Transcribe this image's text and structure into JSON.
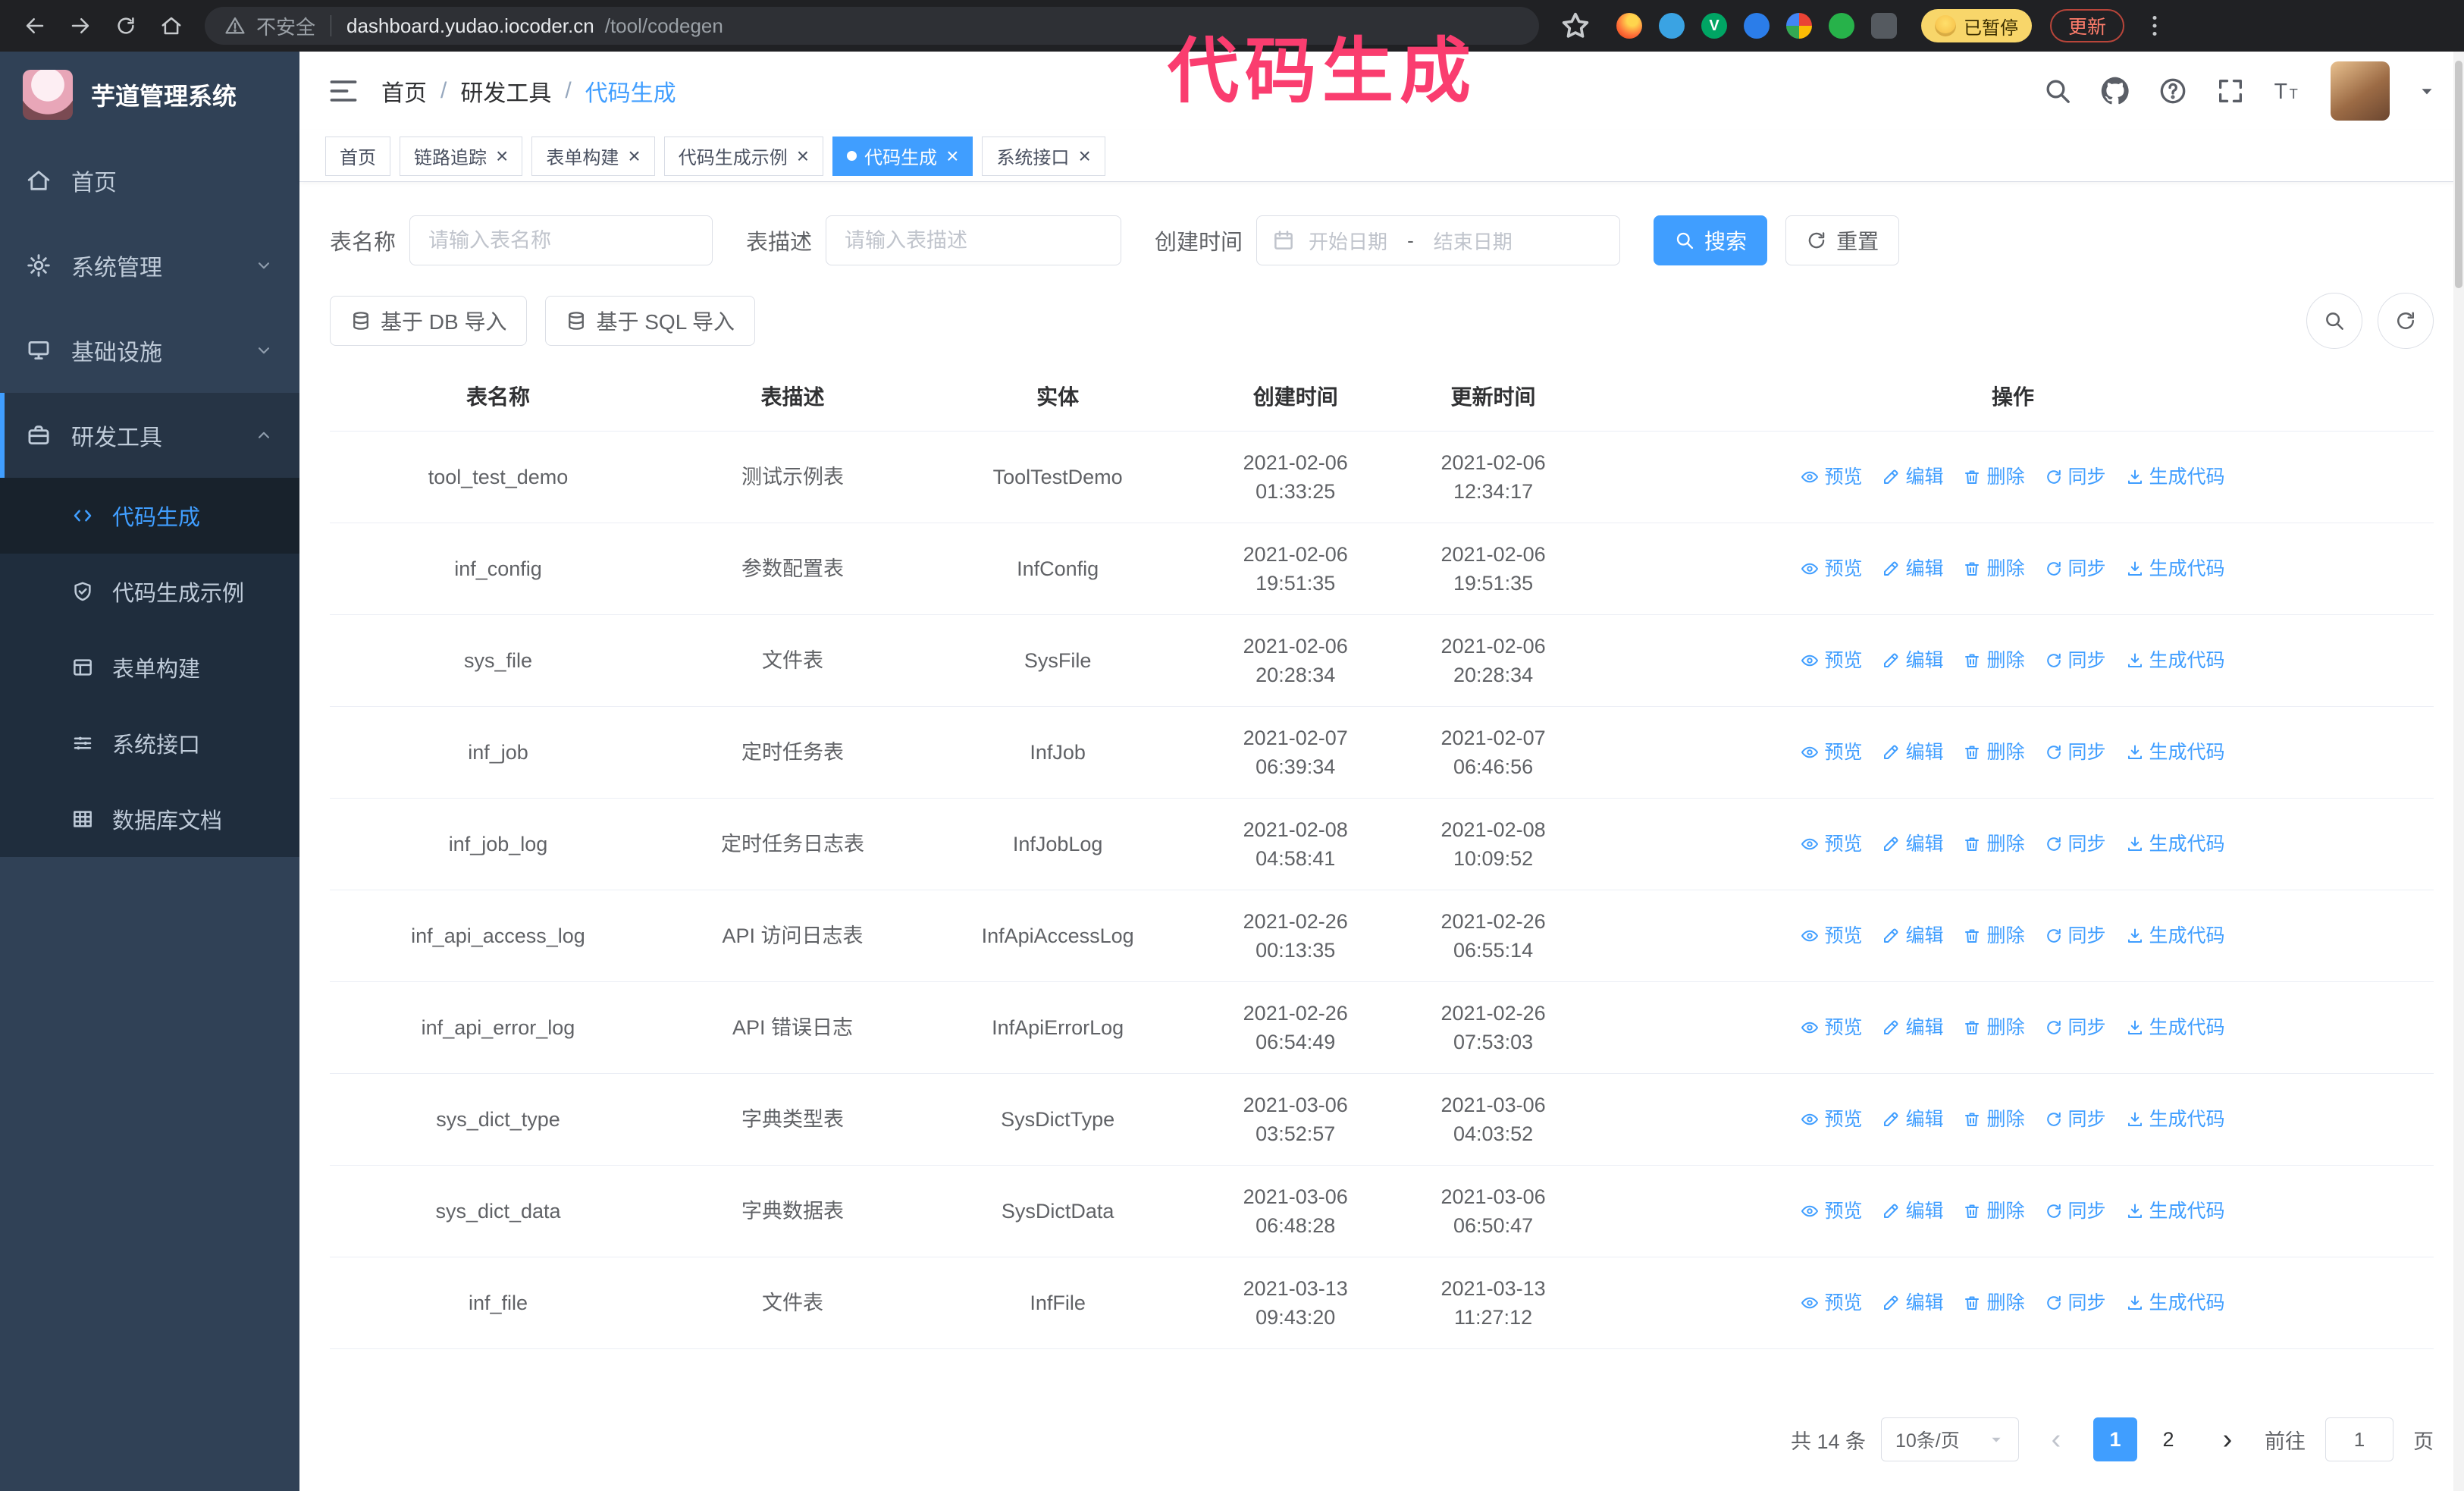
{
  "colors": {
    "primary": "#409eff",
    "annotation": "#fa3d6f"
  },
  "annotation": {
    "text": "代码生成"
  },
  "browser": {
    "security": "不安全",
    "url_host": "dashboard.yudao.iocoder.cn",
    "url_path": "/tool/codegen",
    "paused": "已暂停",
    "update": "更新",
    "extensions": [
      "extension-icon-1",
      "extension-icon-2",
      "extension-icon-3",
      "extension-icon-4",
      "extension-icon-5",
      "extension-icon-6",
      "extension-icon-7"
    ]
  },
  "sidebar": {
    "logo_title": "芋道管理系统",
    "menu": [
      {
        "id": "home",
        "label": "首页",
        "icon": "home-icon"
      },
      {
        "id": "system",
        "label": "系统管理",
        "icon": "gear-icon",
        "expandable": true
      },
      {
        "id": "infra",
        "label": "基础设施",
        "icon": "infra-icon",
        "expandable": true
      },
      {
        "id": "devtools",
        "label": "研发工具",
        "icon": "tools-icon",
        "expandable": true,
        "expanded": true,
        "children": [
          {
            "id": "codegen",
            "label": "代码生成",
            "icon": "code-icon",
            "active": true
          },
          {
            "id": "codegen-example",
            "label": "代码生成示例",
            "icon": "example-icon"
          },
          {
            "id": "form-build",
            "label": "表单构建",
            "icon": "form-icon"
          },
          {
            "id": "api",
            "label": "系统接口",
            "icon": "api-icon"
          },
          {
            "id": "db-doc",
            "label": "数据库文档",
            "icon": "db-icon"
          }
        ]
      }
    ]
  },
  "header": {
    "breadcrumb": [
      "首页",
      "研发工具",
      "代码生成"
    ],
    "icons": [
      "search-icon",
      "github-icon",
      "help-icon",
      "fullscreen-icon",
      "font-size-icon"
    ]
  },
  "tabs": [
    {
      "id": "home",
      "label": "首页",
      "closable": false,
      "active": false
    },
    {
      "id": "trace",
      "label": "链路追踪",
      "closable": true,
      "active": false
    },
    {
      "id": "form-build",
      "label": "表单构建",
      "closable": true,
      "active": false
    },
    {
      "id": "codegen-example",
      "label": "代码生成示例",
      "closable": true,
      "active": false
    },
    {
      "id": "codegen",
      "label": "代码生成",
      "closable": true,
      "active": true
    },
    {
      "id": "api",
      "label": "系统接口",
      "closable": true,
      "active": false
    }
  ],
  "filters": {
    "table_name_label": "表名称",
    "table_name_placeholder": "请输入表名称",
    "table_desc_label": "表描述",
    "table_desc_placeholder": "请输入表描述",
    "create_time_label": "创建时间",
    "date_start": "开始日期",
    "date_separator": "-",
    "date_end": "结束日期",
    "search_label": "搜索",
    "reset_label": "重置"
  },
  "toolbar": {
    "db_import": "基于 DB 导入",
    "sql_import": "基于 SQL 导入"
  },
  "table": {
    "columns": [
      "表名称",
      "表描述",
      "实体",
      "创建时间",
      "更新时间",
      "操作"
    ],
    "actions": [
      {
        "label": "预览",
        "icon": "eye-icon"
      },
      {
        "label": "编辑",
        "icon": "edit-icon"
      },
      {
        "label": "删除",
        "icon": "trash-icon"
      },
      {
        "label": "同步",
        "icon": "sync-icon"
      },
      {
        "label": "生成代码",
        "icon": "download-icon"
      }
    ],
    "rows": [
      {
        "name": "tool_test_demo",
        "desc": "测试示例表",
        "entity": "ToolTestDemo",
        "created": "2021-02-06 01:33:25",
        "updated": "2021-02-06 12:34:17"
      },
      {
        "name": "inf_config",
        "desc": "参数配置表",
        "entity": "InfConfig",
        "created": "2021-02-06 19:51:35",
        "updated": "2021-02-06 19:51:35"
      },
      {
        "name": "sys_file",
        "desc": "文件表",
        "entity": "SysFile",
        "created": "2021-02-06 20:28:34",
        "updated": "2021-02-06 20:28:34"
      },
      {
        "name": "inf_job",
        "desc": "定时任务表",
        "entity": "InfJob",
        "created": "2021-02-07 06:39:34",
        "updated": "2021-02-07 06:46:56"
      },
      {
        "name": "inf_job_log",
        "desc": "定时任务日志表",
        "entity": "InfJobLog",
        "created": "2021-02-08 04:58:41",
        "updated": "2021-02-08 10:09:52"
      },
      {
        "name": "inf_api_access_log",
        "desc": "API 访问日志表",
        "entity": "InfApiAccessLog",
        "created": "2021-02-26 00:13:35",
        "updated": "2021-02-26 06:55:14"
      },
      {
        "name": "inf_api_error_log",
        "desc": "API 错误日志",
        "entity": "InfApiErrorLog",
        "created": "2021-02-26 06:54:49",
        "updated": "2021-02-26 07:53:03"
      },
      {
        "name": "sys_dict_type",
        "desc": "字典类型表",
        "entity": "SysDictType",
        "created": "2021-03-06 03:52:57",
        "updated": "2021-03-06 04:03:52"
      },
      {
        "name": "sys_dict_data",
        "desc": "字典数据表",
        "entity": "SysDictData",
        "created": "2021-03-06 06:48:28",
        "updated": "2021-03-06 06:50:47"
      },
      {
        "name": "inf_file",
        "desc": "文件表",
        "entity": "InfFile",
        "created": "2021-03-13 09:43:20",
        "updated": "2021-03-13 11:27:12"
      }
    ]
  },
  "pagination": {
    "total": "共 14 条",
    "page_size": "10条/页",
    "prev": "‹",
    "next": "›",
    "pages": [
      {
        "label": "1",
        "active": true
      },
      {
        "label": "2",
        "active": false
      }
    ],
    "goto_prefix": "前往",
    "goto_value": "1",
    "goto_suffix": "页"
  }
}
